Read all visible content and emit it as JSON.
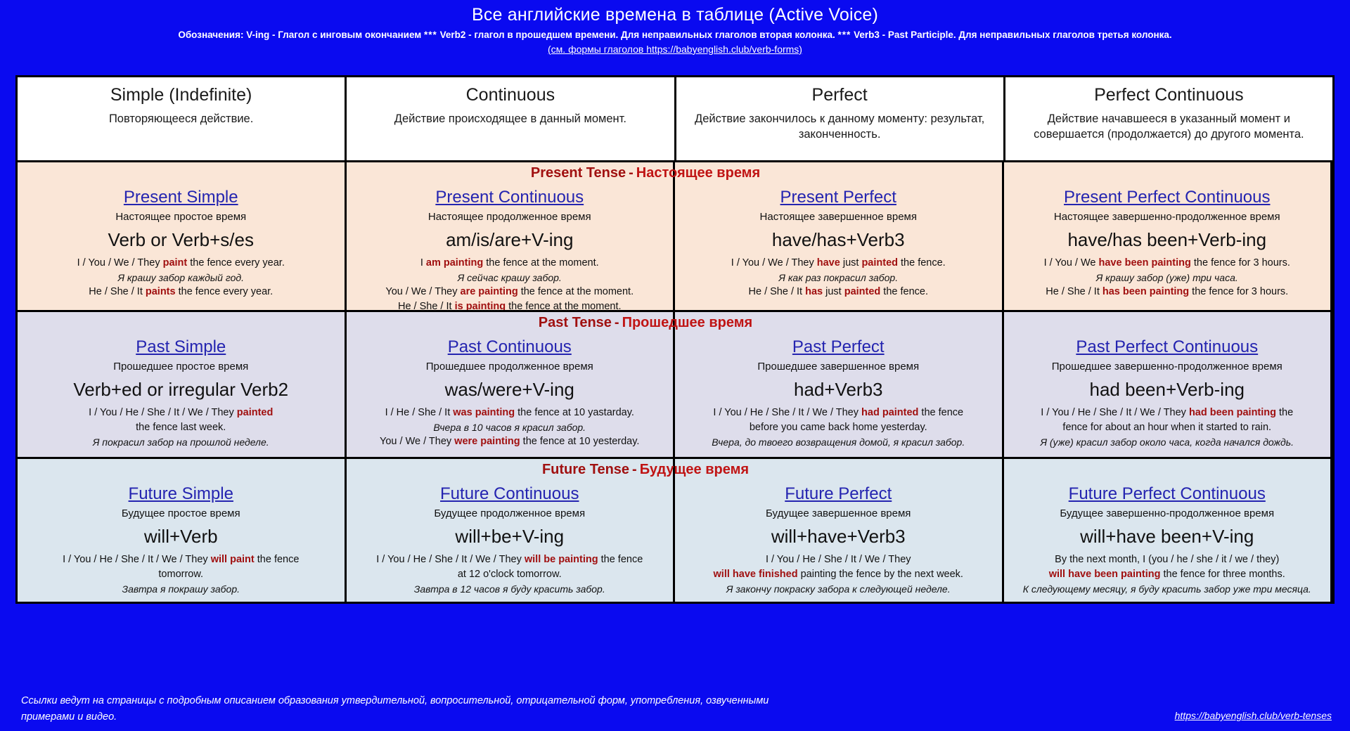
{
  "header": {
    "title": "Все английские времена в таблице (Active Voice)",
    "legend_part1": "Обозначения: V-ing - Глагол с инговым окончанием",
    "legend_sep1": "***",
    "legend_part2": "Verb2 - глагол в прошедшем времени. Для неправильных глаголов вторая колонка.",
    "legend_sep2": "***",
    "legend_part3": "Verb3 - Past Participle. Для неправильных глаголов третья колонка.",
    "verb_forms_link": "(см. формы глаголов https://babyenglish.club/verb-forms)"
  },
  "columns": [
    {
      "title": "Simple (Indefinite)",
      "desc": "Повторяющееся действие."
    },
    {
      "title": "Continuous",
      "desc": "Действие происходящее в данный момент."
    },
    {
      "title": "Perfect",
      "desc": "Действие закончилось к данному моменту: результат, законченность."
    },
    {
      "title": "Perfect Continuous",
      "desc": "Действие начавшееся в указанный момент и совершается (продолжается) до другого момента."
    }
  ],
  "bands": [
    {
      "en": "Present Tense",
      "dash": "-",
      "ru": "Настоящее время"
    },
    {
      "en": "Past Tense",
      "dash": "-",
      "ru": "Прошедшее время"
    },
    {
      "en": "Future Tense",
      "dash": "-",
      "ru": "Будущее время"
    }
  ],
  "rows": [
    {
      "key": "present",
      "cells": [
        {
          "link": "Present Simple",
          "ru": "Настоящее простое время",
          "formula": "Verb or Verb+s/es",
          "examples": [
            {
              "type": "en",
              "parts": [
                {
                  "t": "I / You / We / They "
                },
                {
                  "t": "paint",
                  "hl": true
                },
                {
                  "t": " the fence every year."
                }
              ]
            },
            {
              "type": "ru",
              "text": "Я крашу забор каждый год."
            },
            {
              "type": "en",
              "parts": [
                {
                  "t": "He / She / It "
                },
                {
                  "t": "paints",
                  "hl": true
                },
                {
                  "t": " the fence every year."
                }
              ]
            }
          ]
        },
        {
          "link": "Present Continuous",
          "ru": "Настоящее продолженное время",
          "formula": "am/is/are+V-ing",
          "examples": [
            {
              "type": "en",
              "parts": [
                {
                  "t": "I "
                },
                {
                  "t": "am painting",
                  "hl": true
                },
                {
                  "t": " the fence at the moment."
                }
              ]
            },
            {
              "type": "ru",
              "text": "Я сейчас крашу забор."
            },
            {
              "type": "en",
              "parts": [
                {
                  "t": "You / We / They "
                },
                {
                  "t": "are painting",
                  "hl": true
                },
                {
                  "t": " the fence at the moment."
                }
              ]
            },
            {
              "type": "en",
              "parts": [
                {
                  "t": "He / She / It "
                },
                {
                  "t": "is painting",
                  "hl": true
                },
                {
                  "t": " the fence at the moment."
                }
              ]
            }
          ]
        },
        {
          "link": "Present Perfect",
          "ru": "Настоящее завершенное время",
          "formula": "have/has+Verb3",
          "examples": [
            {
              "type": "en",
              "parts": [
                {
                  "t": "I / You / We / They "
                },
                {
                  "t": "have",
                  "hl": true
                },
                {
                  "t": " just "
                },
                {
                  "t": "painted",
                  "hl": true
                },
                {
                  "t": " the fence."
                }
              ]
            },
            {
              "type": "ru",
              "text": "Я как раз покрасил забор."
            },
            {
              "type": "en",
              "parts": [
                {
                  "t": "He / She / It "
                },
                {
                  "t": "has",
                  "hl": true
                },
                {
                  "t": " just "
                },
                {
                  "t": "painted",
                  "hl": true
                },
                {
                  "t": " the fence."
                }
              ]
            }
          ]
        },
        {
          "link": "Present Perfect Continuous",
          "ru": "Настоящее завершенно-продолженное время",
          "formula": "have/has been+Verb-ing",
          "examples": [
            {
              "type": "en",
              "parts": [
                {
                  "t": "I / You / We "
                },
                {
                  "t": "have been painting",
                  "hl": true
                },
                {
                  "t": " the fence for 3 hours."
                }
              ]
            },
            {
              "type": "ru",
              "text": "Я крашу забор (уже) три часа."
            },
            {
              "type": "en",
              "parts": [
                {
                  "t": "He / She / It "
                },
                {
                  "t": "has been painting",
                  "hl": true
                },
                {
                  "t": " the fence for 3 hours."
                }
              ]
            }
          ]
        }
      ]
    },
    {
      "key": "past",
      "cells": [
        {
          "link": "Past Simple",
          "ru": "Прошедшее простое время",
          "formula": "Verb+ed or irregular Verb2",
          "examples": [
            {
              "type": "en",
              "parts": [
                {
                  "t": "I / You / He / She / It / We / They "
                },
                {
                  "t": "painted",
                  "hl": true
                }
              ]
            },
            {
              "type": "en",
              "parts": [
                {
                  "t": "the fence last week."
                }
              ]
            },
            {
              "type": "ru",
              "text": "Я покрасил забор на прошлой неделе."
            }
          ]
        },
        {
          "link": "Past Continuous",
          "ru": "Прошедшее продолженное время",
          "formula": "was/were+V-ing",
          "examples": [
            {
              "type": "en",
              "parts": [
                {
                  "t": "I /  He / She / It  "
                },
                {
                  "t": "was painting",
                  "hl": true
                },
                {
                  "t": " the fence  at 10 yastarday."
                }
              ]
            },
            {
              "type": "ru",
              "text": "Вчера в 10 часов я красил забор."
            },
            {
              "type": "en",
              "parts": [
                {
                  "t": "You / We / They "
                },
                {
                  "t": "were painting",
                  "hl": true
                },
                {
                  "t": " the fence at 10 yesterday."
                }
              ]
            }
          ]
        },
        {
          "link": "Past Perfect",
          "ru": "Прошедшее завершенное время",
          "formula": "had+Verb3",
          "examples": [
            {
              "type": "en",
              "parts": [
                {
                  "t": "I / You / He / She / It / We / They "
                },
                {
                  "t": "had painted",
                  "hl": true
                },
                {
                  "t": " the fence"
                }
              ]
            },
            {
              "type": "en",
              "parts": [
                {
                  "t": "before you came back home yesterday."
                }
              ]
            },
            {
              "type": "ru",
              "text": "Вчера, до твоего возвращения домой, я красил забор."
            }
          ]
        },
        {
          "link": "Past Perfect Continuous",
          "ru": "Прошедшее завершенно-продолженное время",
          "formula": "had been+Verb-ing",
          "examples": [
            {
              "type": "en",
              "parts": [
                {
                  "t": "I / You / He / She / It / We / They "
                },
                {
                  "t": "had been painting",
                  "hl": true
                },
                {
                  "t": " the"
                }
              ]
            },
            {
              "type": "en",
              "parts": [
                {
                  "t": "fence for about an hour when it started to rain."
                }
              ]
            },
            {
              "type": "ru",
              "text": "Я (уже) красил забор около часа, когда начался дождь."
            }
          ]
        }
      ]
    },
    {
      "key": "future",
      "cells": [
        {
          "link": "Future Simple",
          "ru": "Будущее простое время",
          "formula": "will+Verb",
          "examples": [
            {
              "type": "en",
              "parts": [
                {
                  "t": "I / You / He / She / It / We / They "
                },
                {
                  "t": "will paint",
                  "hl": true
                },
                {
                  "t": " the fence"
                }
              ]
            },
            {
              "type": "en",
              "parts": [
                {
                  "t": "tomorrow."
                }
              ]
            },
            {
              "type": "ru",
              "text": "Завтра я покрашу забор."
            }
          ]
        },
        {
          "link": "Future Continuous",
          "ru": "Будущее продолженное время",
          "formula": "will+be+V-ing",
          "examples": [
            {
              "type": "en",
              "parts": [
                {
                  "t": "I / You / He / She / It / We / They "
                },
                {
                  "t": "will be painting",
                  "hl": true
                },
                {
                  "t": " the fence"
                }
              ]
            },
            {
              "type": "en",
              "parts": [
                {
                  "t": "at 12 o'clock tomorrow."
                }
              ]
            },
            {
              "type": "ru",
              "text": "Завтра в 12 часов я буду красить забор."
            }
          ]
        },
        {
          "link": "Future Perfect",
          "ru": "Будущее завершенное время",
          "formula": "will+have+Verb3",
          "examples": [
            {
              "type": "en",
              "parts": [
                {
                  "t": "I / You / He / She / It / We / They"
                }
              ]
            },
            {
              "type": "en",
              "parts": [
                {
                  "t": "will have finished",
                  "hl": true
                },
                {
                  "t": " painting the fence by the next week."
                }
              ]
            },
            {
              "type": "ru",
              "text": "Я закончу покраску забора к следующей неделе."
            }
          ]
        },
        {
          "link": "Future Perfect Continuous",
          "ru": "Будущее завершенно-продолженное время",
          "formula": "will+have been+V-ing",
          "examples": [
            {
              "type": "en",
              "parts": [
                {
                  "t": "By the next month, I (you / he / she / it / we / they)"
                }
              ]
            },
            {
              "type": "en",
              "parts": [
                {
                  "t": "will have been painting",
                  "hl": true
                },
                {
                  "t": " the fence for three months."
                }
              ]
            },
            {
              "type": "ru",
              "text": "К следующему месяцу, я буду красить забор уже три месяца."
            }
          ]
        }
      ]
    }
  ],
  "footer": {
    "note": "Ссылки ведут на страницы с подробным описанием  образования утвердительной, вопросительной, отрицательной форм, употребления, озвученными примерами и видео.",
    "link": "https://babyenglish.club/verb-tenses"
  },
  "colors": {
    "background": "#0A0AF0",
    "present_row": "#FAE6D7",
    "past_row": "#DEDDEB",
    "future_row": "#DBE6EE",
    "link": "#2424B0",
    "highlight": "#A01010",
    "band_ru": "#C01414"
  }
}
